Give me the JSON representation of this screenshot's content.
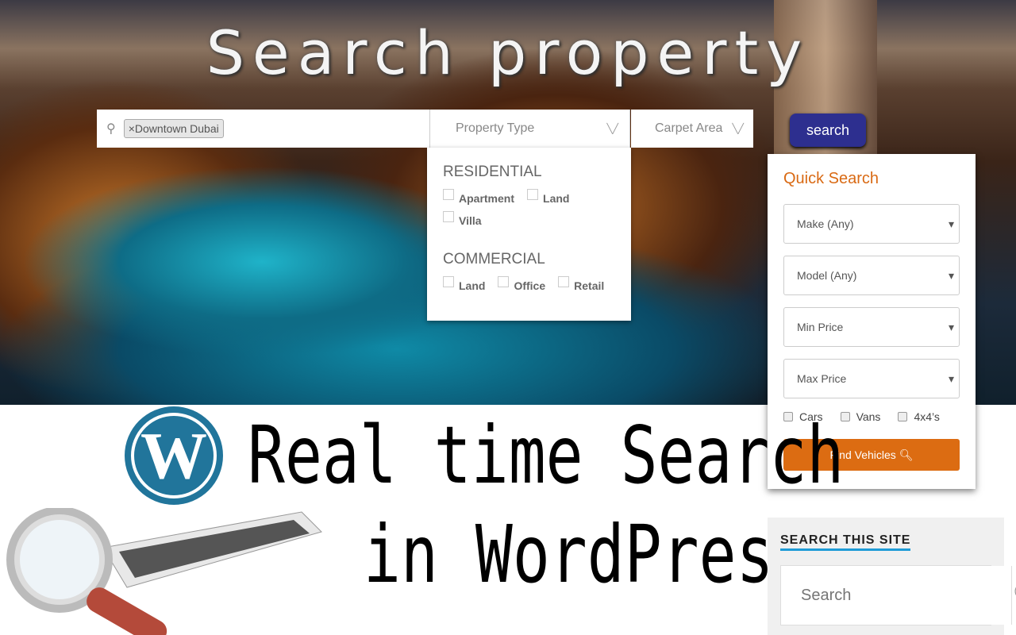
{
  "hero": {
    "title": "Search property"
  },
  "search_bar": {
    "location_tag": "Downtown Dubai",
    "tag_remove": "×",
    "property_type": "Property Type",
    "carpet_area": "Carpet Area",
    "search_button": "search"
  },
  "dropdown": {
    "groups": [
      {
        "heading": "RESIDENTIAL",
        "options": [
          "Apartment",
          "Land",
          "Villa"
        ]
      },
      {
        "heading": "COMMERCIAL",
        "options": [
          "Land",
          "Office",
          "Retail"
        ]
      }
    ]
  },
  "quick_search": {
    "title": "Quick Search",
    "selects": [
      "Make (Any)",
      "Model (Any)",
      "Min Price",
      "Max Price"
    ],
    "checkboxes": [
      "Cars",
      "Vans",
      "4x4’s"
    ],
    "button": "Find Vehicles",
    "accent": "#dc6c12"
  },
  "banner": {
    "line1": "Real time Search",
    "line2": "in WordPress",
    "logo_letter": "W",
    "key_text": "search"
  },
  "site_search": {
    "heading": "SEARCH THIS SITE",
    "placeholder": "Search",
    "accent": "#1e9bd7"
  }
}
